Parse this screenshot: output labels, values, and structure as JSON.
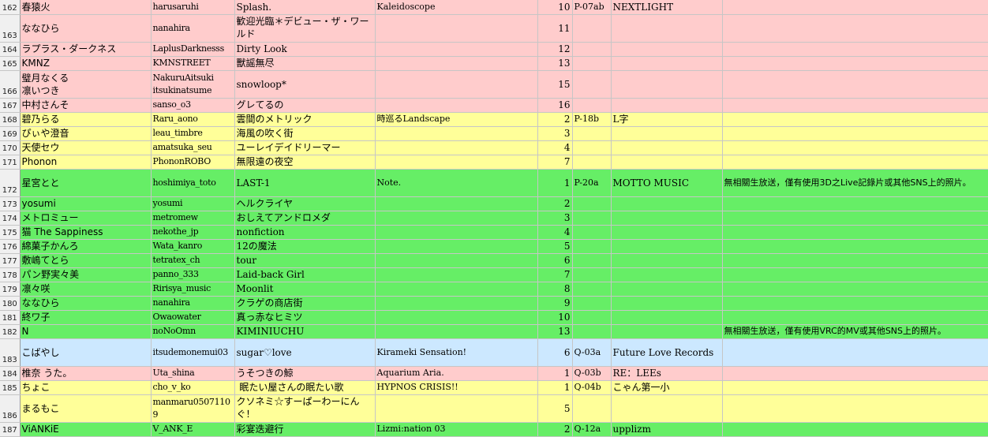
{
  "colors": {
    "pink": "#ffcccc",
    "yellow": "#ffff99",
    "green": "#66ee66",
    "blue": "#cce8ff",
    "row_header": "#f0f0f0",
    "grid": "#c6c6c6"
  },
  "rows": [
    {
      "num": "162",
      "color": "pink",
      "name": "春猿火",
      "handle": "harusaruhi",
      "song": "Splash.",
      "album": "Kaleidoscope",
      "order": "10",
      "booth": "P-07ab",
      "circle": "NEXTLIGHT",
      "note": ""
    },
    {
      "num": "163",
      "color": "pink",
      "name": "ななひら",
      "handle": "nanahira",
      "song": "歓迎光臨＊デビュー・ザ・ワールド",
      "album": "",
      "order": "11",
      "booth": "",
      "circle": "",
      "note": ""
    },
    {
      "num": "164",
      "color": "pink",
      "name": "ラプラス・ダークネス",
      "handle": "LaplusDarknesss",
      "song": "Dirty Look",
      "album": "",
      "order": "12",
      "booth": "",
      "circle": "",
      "note": ""
    },
    {
      "num": "165",
      "color": "pink",
      "name": "KMNZ",
      "handle": "KMNSTREET",
      "song": "獸謡無尽",
      "album": "",
      "order": "13",
      "booth": "",
      "circle": "",
      "note": ""
    },
    {
      "num": "166",
      "color": "pink",
      "name": "璧月なくる\n凛いつき",
      "handle": "NakuruAitsuki\nitsukinatsume",
      "song": "snowloop*",
      "album": "",
      "order": "15",
      "booth": "",
      "circle": "",
      "note": ""
    },
    {
      "num": "167",
      "color": "pink",
      "name": "中村さんそ",
      "handle": "sanso_o3",
      "song": "グレてるの",
      "album": "",
      "order": "16",
      "booth": "",
      "circle": "",
      "note": ""
    },
    {
      "num": "168",
      "color": "yellow",
      "name": "碧乃らる",
      "handle": "Raru_aono",
      "song": "雲間のメトリック",
      "album": "時巡るLandscape",
      "order": "2",
      "booth": "P-18b",
      "circle": "L字",
      "note": ""
    },
    {
      "num": "169",
      "color": "yellow",
      "name": "ぴぃや澄音",
      "handle": "leau_timbre",
      "song": "海風の吹く街",
      "album": "",
      "order": "3",
      "booth": "",
      "circle": "",
      "note": ""
    },
    {
      "num": "170",
      "color": "yellow",
      "name": "天使セウ",
      "handle": "amatsuka_seu",
      "song": "ユーレイデイドリーマー",
      "album": "",
      "order": "4",
      "booth": "",
      "circle": "",
      "note": ""
    },
    {
      "num": "171",
      "color": "yellow",
      "name": "Phonon",
      "handle": "PhononROBO",
      "song": "無限遠の夜空",
      "album": "",
      "order": "7",
      "booth": "",
      "circle": "",
      "note": ""
    },
    {
      "num": "172",
      "color": "green",
      "name": "星宮とと",
      "handle": "hoshimiya_toto",
      "song": "LAST-1",
      "album": "Note.",
      "order": "1",
      "booth": "P-20a",
      "circle": "MOTTO MUSIC",
      "note": "無相關生放送，僅有使用3D之Live記錄片或其他SNS上的照片。"
    },
    {
      "num": "173",
      "color": "green",
      "name": "yosumi",
      "handle": "yosumi",
      "song": "ヘルクライヤ",
      "album": "",
      "order": "2",
      "booth": "",
      "circle": "",
      "note": ""
    },
    {
      "num": "174",
      "color": "green",
      "name": "メトロミュー",
      "handle": "metromew",
      "song": "おしえてアンドロメダ",
      "album": "",
      "order": "3",
      "booth": "",
      "circle": "",
      "note": ""
    },
    {
      "num": "175",
      "color": "green",
      "name": "猫 The Sappiness",
      "handle": "nekothe_jp",
      "song": "nonfiction",
      "album": "",
      "order": "4",
      "booth": "",
      "circle": "",
      "note": ""
    },
    {
      "num": "176",
      "color": "green",
      "name": "綿菓子かんろ",
      "handle": "Wata_kanro",
      "song": "12の魔法",
      "album": "",
      "order": "5",
      "booth": "",
      "circle": "",
      "note": ""
    },
    {
      "num": "177",
      "color": "green",
      "name": "敷嶋てとら",
      "handle": "tetratex_ch",
      "song": "tour",
      "album": "",
      "order": "6",
      "booth": "",
      "circle": "",
      "note": ""
    },
    {
      "num": "178",
      "color": "green",
      "name": "パン野実々美",
      "handle": "panno_333",
      "song": "Laid-back Girl",
      "album": "",
      "order": "7",
      "booth": "",
      "circle": "",
      "note": ""
    },
    {
      "num": "179",
      "color": "green",
      "name": "凛々咲",
      "handle": "Ririsya_music",
      "song": "Moonlit",
      "album": "",
      "order": "8",
      "booth": "",
      "circle": "",
      "note": ""
    },
    {
      "num": "180",
      "color": "green",
      "name": "ななひら",
      "handle": "nanahira",
      "song": "クラゲの商店街",
      "album": "",
      "order": "9",
      "booth": "",
      "circle": "",
      "note": ""
    },
    {
      "num": "181",
      "color": "green",
      "name": "終ワ子",
      "handle": "Owaowater",
      "song": "真っ赤なヒミツ",
      "album": "",
      "order": "10",
      "booth": "",
      "circle": "",
      "note": ""
    },
    {
      "num": "182",
      "color": "green",
      "name": "N",
      "handle": "noNoOmn",
      "song": "KIMINIUCHU",
      "album": "",
      "order": "13",
      "booth": "",
      "circle": "",
      "note": "無相關生放送，僅有使用VRC的MV或其他SNS上的照片。"
    },
    {
      "num": "183",
      "color": "blue",
      "name": "こばやし",
      "handle": "itsudemonemui03",
      "song": "sugar♡love",
      "album": "Kirameki Sensation!",
      "order": "6",
      "booth": "Q-03a",
      "circle": "Future Love Records",
      "note": ""
    },
    {
      "num": "184",
      "color": "pink",
      "name": "椎奈 うた。",
      "handle": "Uta_shina",
      "song": "うそつきの鯨",
      "album": "Aquarium Aria.",
      "order": "1",
      "booth": "Q-03b",
      "circle": "RE：LEEs",
      "note": ""
    },
    {
      "num": "185",
      "color": "yellow",
      "name": "ちょこ",
      "handle": "cho_v_ko",
      "song": " 眠たい屋さんの眠たい歌",
      "album": "HYPNOS CRISIS!!",
      "order": "1",
      "booth": "Q-04b",
      "circle": "こゃん第一小",
      "note": ""
    },
    {
      "num": "186",
      "color": "yellow",
      "name": "まるもこ",
      "handle": "manmaru05071109",
      "song": "クソネミ☆すーぱーわーにんぐ！",
      "album": "",
      "order": "5",
      "booth": "",
      "circle": "",
      "note": ""
    },
    {
      "num": "187",
      "color": "green",
      "name": "ViANKiE",
      "handle": "V_ANK_E",
      "song": "彩宴迭避行",
      "album": "Lizmi:nation 03",
      "order": "2",
      "booth": "Q-12a",
      "circle": "upplizm",
      "note": ""
    }
  ]
}
